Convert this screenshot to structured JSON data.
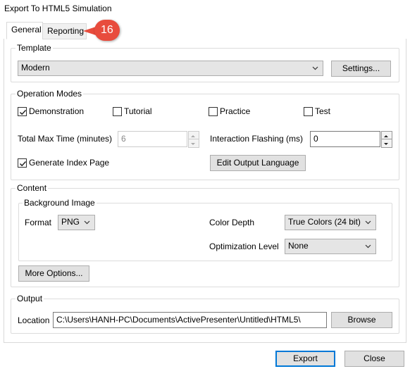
{
  "window": {
    "title": "Export To HTML5 Simulation"
  },
  "tabs": [
    {
      "label": "General",
      "active": true
    },
    {
      "label": "Reporting",
      "active": false
    }
  ],
  "callout": {
    "number": "16",
    "color": "#e84c3d"
  },
  "template": {
    "group_title": "Template",
    "selected": "Modern",
    "settings_label": "Settings..."
  },
  "operation_modes": {
    "group_title": "Operation Modes",
    "modes": [
      {
        "label": "Demonstration",
        "checked": true
      },
      {
        "label": "Tutorial",
        "checked": false
      },
      {
        "label": "Practice",
        "checked": false
      },
      {
        "label": "Test",
        "checked": false
      }
    ],
    "total_max_time_label": "Total Max Time (minutes)",
    "total_max_time_value": "6",
    "interaction_flashing_label": "Interaction Flashing (ms)",
    "interaction_flashing_value": "0",
    "generate_index_label": "Generate Index Page",
    "generate_index_checked": true,
    "edit_output_language_label": "Edit Output Language"
  },
  "content": {
    "group_title": "Content",
    "background_image": {
      "group_title": "Background Image",
      "format_label": "Format",
      "format_value": "PNG",
      "color_depth_label": "Color Depth",
      "color_depth_value": "True Colors (24 bit)",
      "optimization_label": "Optimization Level",
      "optimization_value": "None"
    },
    "more_options_label": "More Options..."
  },
  "output": {
    "group_title": "Output",
    "location_label": "Location",
    "location_value": "C:\\Users\\HANH-PC\\Documents\\ActivePresenter\\Untitled\\HTML5\\",
    "browse_label": "Browse"
  },
  "footer": {
    "export_label": "Export",
    "close_label": "Close"
  }
}
